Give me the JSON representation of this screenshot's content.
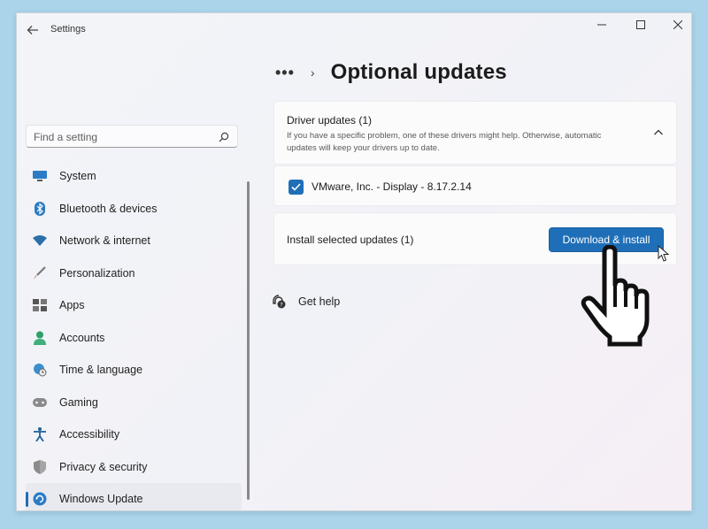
{
  "window": {
    "app_title": "Settings"
  },
  "sidebar": {
    "search_placeholder": "Find a setting",
    "items": [
      {
        "label": "System",
        "icon": "system-icon"
      },
      {
        "label": "Bluetooth & devices",
        "icon": "bluetooth-icon"
      },
      {
        "label": "Network & internet",
        "icon": "wifi-icon"
      },
      {
        "label": "Personalization",
        "icon": "brush-icon"
      },
      {
        "label": "Apps",
        "icon": "apps-icon"
      },
      {
        "label": "Accounts",
        "icon": "accounts-icon"
      },
      {
        "label": "Time & language",
        "icon": "globe-clock-icon"
      },
      {
        "label": "Gaming",
        "icon": "gamepad-icon"
      },
      {
        "label": "Accessibility",
        "icon": "accessibility-icon"
      },
      {
        "label": "Privacy & security",
        "icon": "shield-icon"
      },
      {
        "label": "Windows Update",
        "icon": "windows-update-icon",
        "active": true
      }
    ]
  },
  "main": {
    "breadcrumb_more": "•••",
    "breadcrumb_sep": "›",
    "page_title": "Optional updates",
    "driver_card": {
      "title": "Driver updates (1)",
      "description": "If you have a specific problem, one of these drivers might help. Otherwise, automatic updates will keep your drivers up to date.",
      "expanded": true
    },
    "driver_item": {
      "label": "VMware, Inc. - Display - 8.17.2.14",
      "checked": true
    },
    "install_card": {
      "label": "Install selected updates (1)",
      "button_label": "Download & install"
    },
    "help": {
      "label": "Get help"
    }
  },
  "colors": {
    "accent": "#1f6fb8",
    "background": "#a9d4ea",
    "window": "#f3f4f8"
  }
}
